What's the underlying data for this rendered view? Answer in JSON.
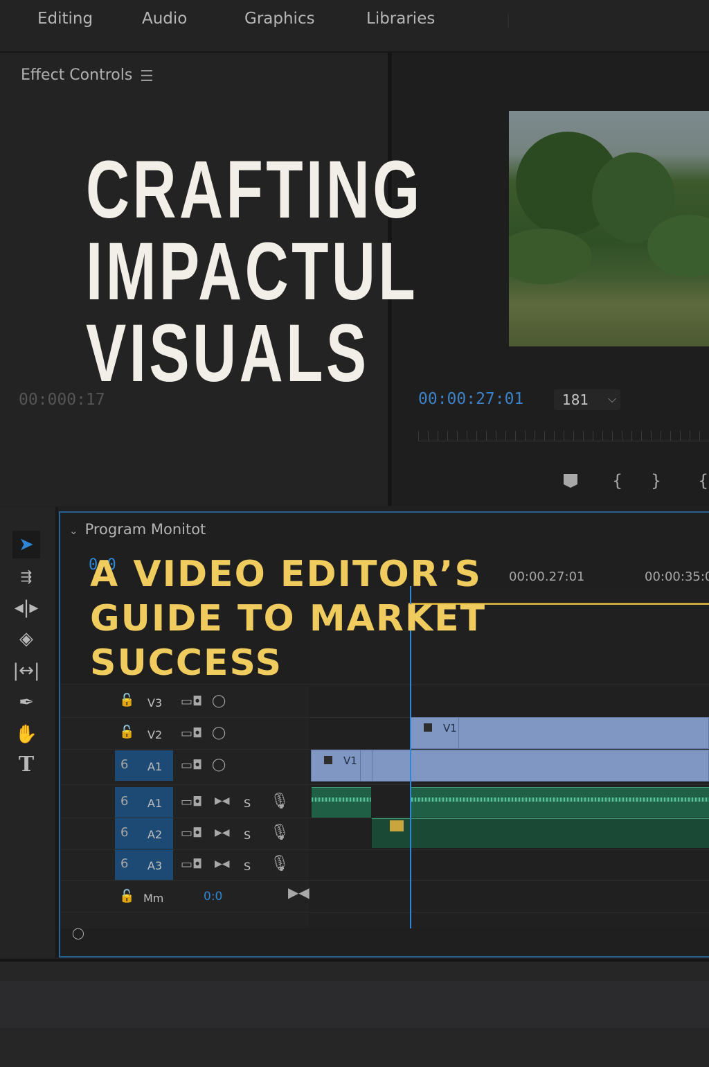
{
  "workspace_tabs": [
    "Editing",
    "Audio",
    "Graphics",
    "Libraries"
  ],
  "effect_controls": {
    "title": "Effect Controls",
    "menu_icon": "hamburger-menu-icon",
    "timecode": "00:000:17"
  },
  "program": {
    "timecode": "00:00:27:01",
    "zoom_value": "181",
    "zoom_caret": "⌵"
  },
  "timeline": {
    "title": "Program Monitot",
    "timecode": "0:0",
    "ruler_labels": [
      "00:00.27:01",
      "00:00:35:0"
    ],
    "tracks": [
      {
        "name": "V3",
        "lock": "🔓",
        "type": "video"
      },
      {
        "name": "V2",
        "lock": "🔓",
        "type": "video"
      },
      {
        "name": "A1",
        "lock": "6",
        "type": "video"
      },
      {
        "name": "A1",
        "lock": "6",
        "type": "audio",
        "solo": "S"
      },
      {
        "name": "A2",
        "lock": "6",
        "type": "audio",
        "solo": "S"
      },
      {
        "name": "A3",
        "lock": "6",
        "type": "audio",
        "solo": "S"
      }
    ],
    "master": {
      "label": "Mm",
      "value": "0:0"
    },
    "clips": {
      "v2_clip": "V1",
      "a1_clip": "V1"
    }
  },
  "overlay": {
    "headline_lines": [
      "CRAFTING",
      "IMPACTUL",
      "VISUALS"
    ],
    "subhead_lines": [
      "A VIDEO EDITOR’S",
      "GUIDE TO MARKET",
      "SUCCESS"
    ]
  },
  "colors": {
    "headline": "#f1efe8",
    "subhead": "#f0cc5f",
    "accent_blue": "#2f86d6",
    "video_clip": "#7f97c2",
    "audio_clip": "#1f5f45"
  }
}
